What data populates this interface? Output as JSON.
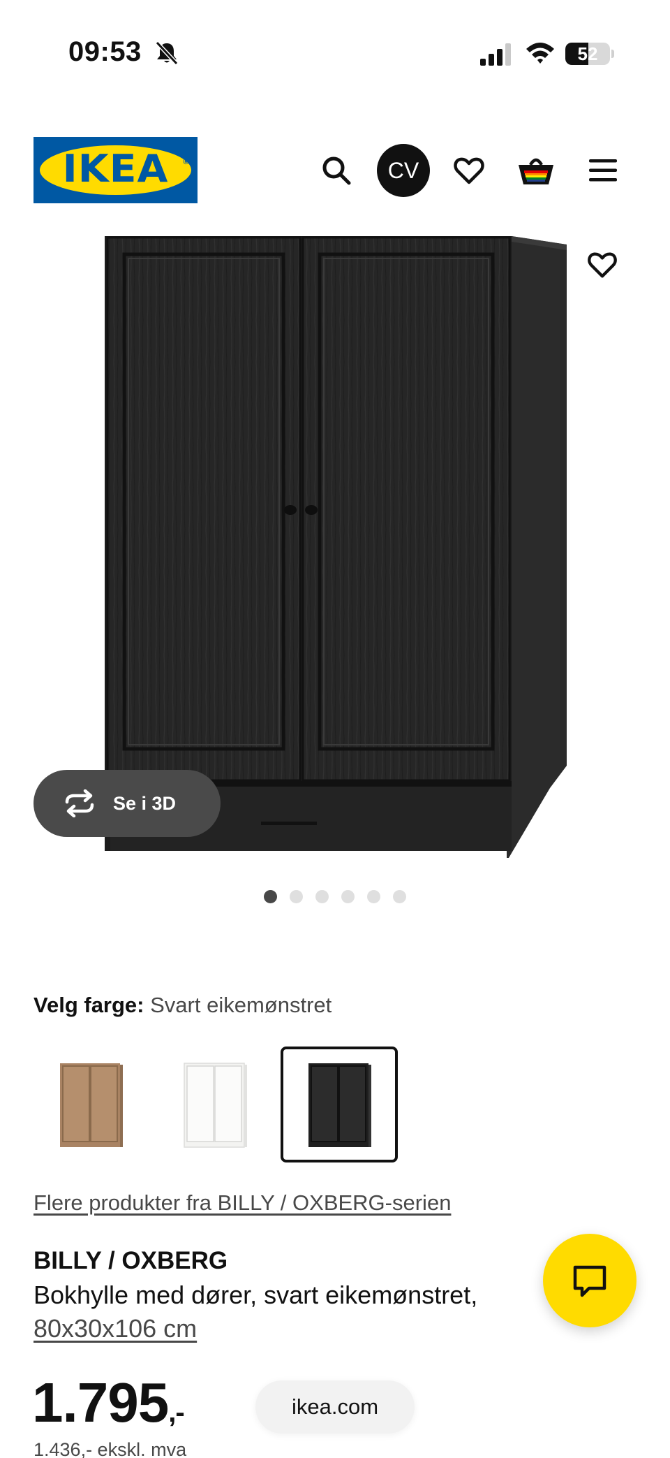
{
  "status_bar": {
    "time": "09:53",
    "battery": "52",
    "battery_level_percent": 52,
    "icons": [
      "bell-slash-icon",
      "cellular-signal-icon",
      "wifi-icon",
      "battery-icon"
    ]
  },
  "header": {
    "logo_text": "IKEA",
    "logo_registered": "®",
    "avatar_initials": "CV",
    "icons": [
      "search-icon",
      "heart-icon",
      "basket-icon",
      "menu-icon"
    ],
    "brand_colors": {
      "blue": "#0058a3",
      "yellow": "#ffdb00"
    }
  },
  "gallery": {
    "view_3d_label": "Se i 3D",
    "image_count": 6,
    "active_image_index": 0
  },
  "color_picker": {
    "label": "Velg farge:",
    "selected_value": "Svart eikemønstret",
    "swatches": [
      {
        "color": "#b08a66",
        "selected": false
      },
      {
        "color": "#f4f4f2",
        "selected": false
      },
      {
        "color": "#2a2a2a",
        "selected": true
      }
    ]
  },
  "series_link": "Flere produkter fra BILLY / OXBERG-serien",
  "product": {
    "name": "BILLY / OXBERG",
    "description": "Bokhylle med dører, svart eikemønstret,",
    "size": "80x30x106 cm",
    "price": "1.795",
    "price_suffix": ",-",
    "price_ex_vat": "1.436,- ekskl. mva"
  },
  "browser": {
    "url": "ikea.com"
  },
  "chat": {
    "icon": "chat-icon",
    "color": "#ffdb00"
  }
}
